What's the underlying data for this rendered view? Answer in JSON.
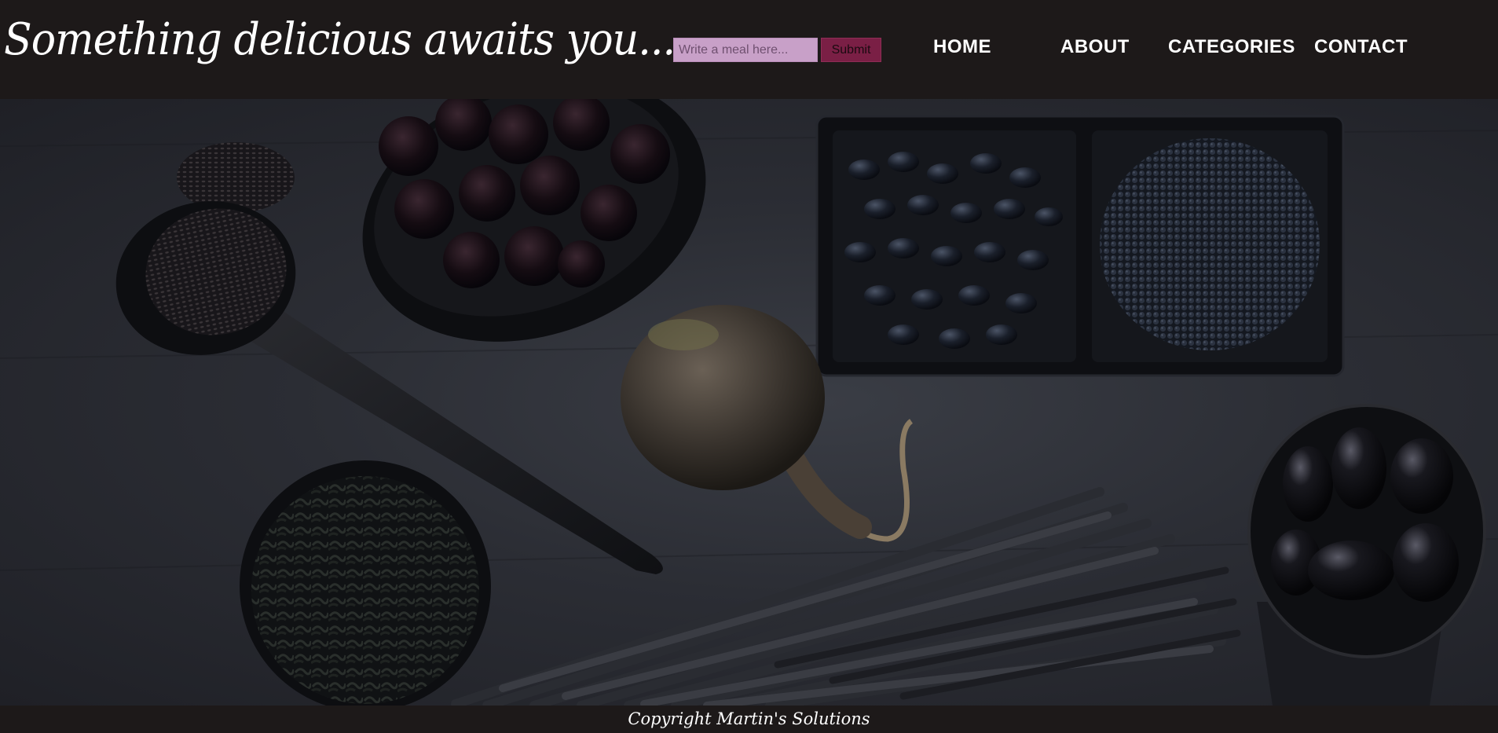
{
  "header": {
    "title": "Something delicious awaits you...",
    "search": {
      "placeholder": "Write a meal here...",
      "value": ""
    },
    "submit_label": "Submit"
  },
  "nav": {
    "items": [
      {
        "label": "HOME"
      },
      {
        "label": "ABOUT"
      },
      {
        "label": "CATEGORIES"
      },
      {
        "label": "CONTACT"
      }
    ]
  },
  "footer": {
    "copyright": "Copyright Martin's Solutions"
  },
  "colors": {
    "background": "#1d1919",
    "search_bg": "#c8a0c8",
    "submit_bg": "#7a1f45",
    "nav_text": "#ffffff"
  }
}
